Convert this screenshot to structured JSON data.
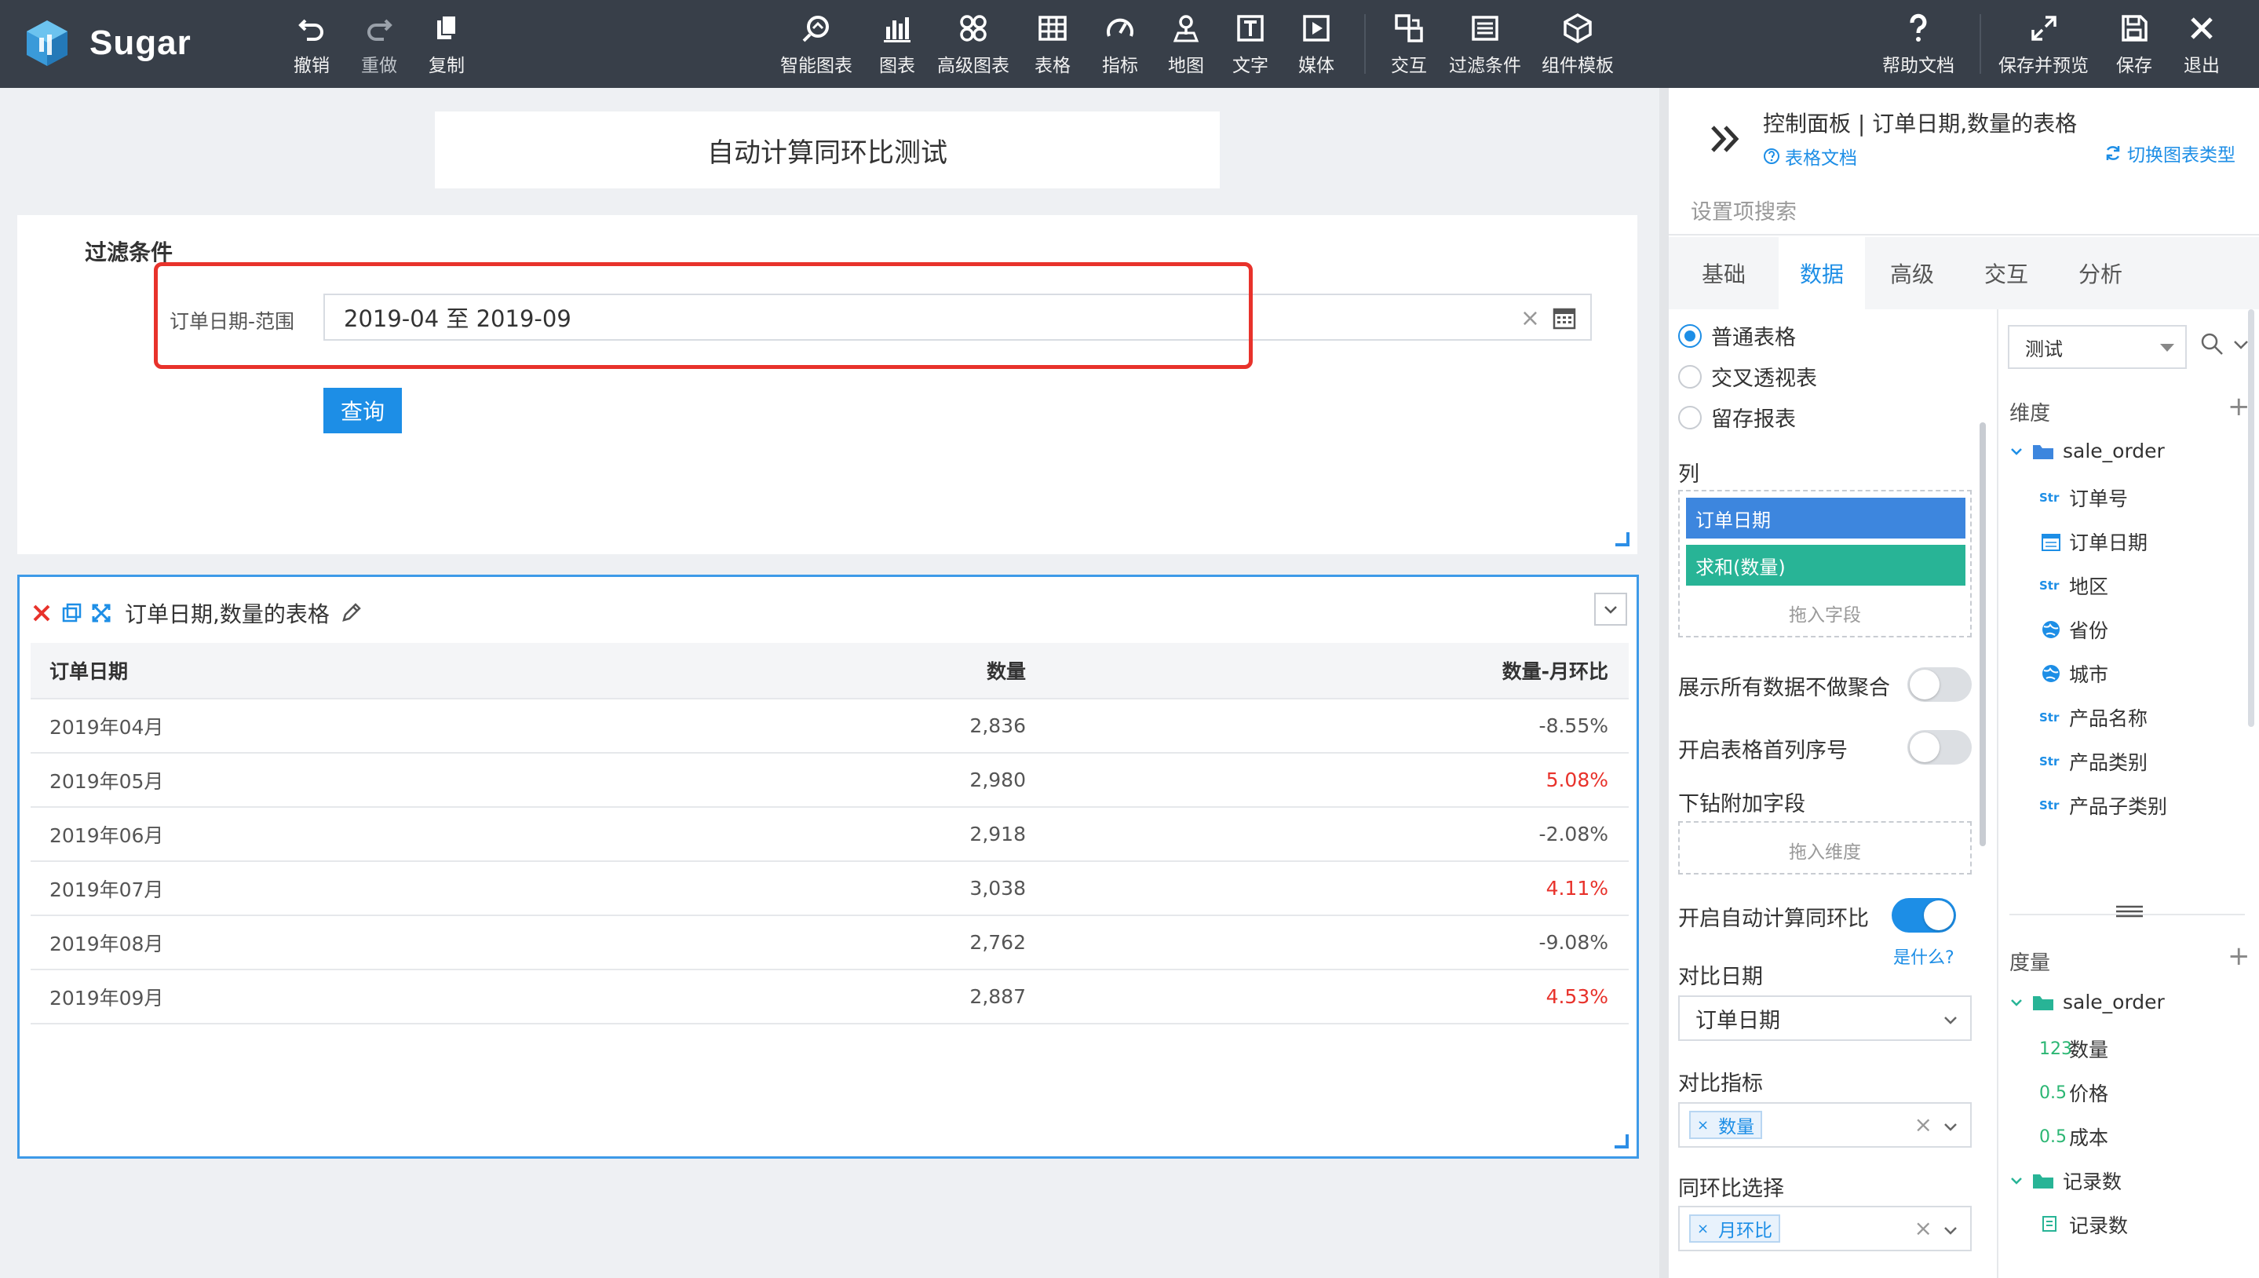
{
  "app": {
    "name": "Sugar",
    "colors": {
      "topbar": "#383f49",
      "accent": "#1d8ee6",
      "danger": "#e8322b",
      "field_blue": "#3d86de",
      "measure_green": "#28b496"
    }
  },
  "toolbar": {
    "undo": "撤销",
    "redo": "重做",
    "copy": "复制",
    "smart_chart": "智能图表",
    "chart": "图表",
    "adv_chart": "高级图表",
    "table": "表格",
    "indicator": "指标",
    "map": "地图",
    "text": "文字",
    "media": "媒体",
    "interact": "交互",
    "filter": "过滤条件",
    "widget_tpl": "组件模板",
    "help": "帮助文档",
    "save_preview": "保存并预览",
    "save": "保存",
    "exit": "退出"
  },
  "canvas": {
    "page_title": "自动计算同环比测试",
    "filter": {
      "title": "过滤条件",
      "field_label": "订单日期-范围",
      "value": "2019-04 至 2019-09",
      "clear_glyph": "×",
      "query_btn": "查询"
    },
    "table_widget": {
      "title": "订单日期,数量的表格",
      "columns": [
        "订单日期",
        "数量",
        "数量-月环比"
      ],
      "rows": [
        {
          "date": "2019年04月",
          "qty": "2,836",
          "mom": "-8.55%",
          "up": false
        },
        {
          "date": "2019年05月",
          "qty": "2,980",
          "mom": "5.08%",
          "up": true
        },
        {
          "date": "2019年06月",
          "qty": "2,918",
          "mom": "-2.08%",
          "up": false
        },
        {
          "date": "2019年07月",
          "qty": "3,038",
          "mom": "4.11%",
          "up": true
        },
        {
          "date": "2019年08月",
          "qty": "2,762",
          "mom": "-9.08%",
          "up": false
        },
        {
          "date": "2019年09月",
          "qty": "2,887",
          "mom": "4.53%",
          "up": true
        }
      ]
    }
  },
  "panel": {
    "title": "控制面板 | 订单日期,数量的表格",
    "doc_link": "表格文档",
    "switch_link": "切换图表类型",
    "search_placeholder": "设置项搜索",
    "tabs": [
      "基础",
      "数据",
      "高级",
      "交互",
      "分析"
    ],
    "active_tab": "数据",
    "table_types": [
      "普通表格",
      "交叉透视表",
      "留存报表"
    ],
    "columns_label": "列",
    "column_chips": [
      "订单日期",
      "求和(数量)"
    ],
    "drop_field_hint": "拖入字段",
    "show_all_label": "展示所有数据不做聚合",
    "row_index_label": "开启表格首列序号",
    "drill_label": "下钻附加字段",
    "drop_dim_hint": "拖入维度",
    "auto_calc_label": "开启自动计算同环比",
    "what_link": "是什么?",
    "compare_date_label": "对比日期",
    "compare_date_value": "订单日期",
    "compare_metric_label": "对比指标",
    "compare_metric_tag": "数量",
    "period_label": "同环比选择",
    "period_tag": "月环比",
    "clear_glyph": "×",
    "tag_x": "×"
  },
  "fields": {
    "dataset": "测试",
    "dim_label": "维度",
    "measure_label": "度量",
    "plus": "+",
    "dim_table": "sale_order",
    "dims": [
      {
        "type": "Str",
        "name": "订单号"
      },
      {
        "type": "date",
        "name": "订单日期"
      },
      {
        "type": "Str",
        "name": "地区"
      },
      {
        "type": "geo",
        "name": "省份"
      },
      {
        "type": "geo",
        "name": "城市"
      },
      {
        "type": "Str",
        "name": "产品名称"
      },
      {
        "type": "Str",
        "name": "产品类别"
      },
      {
        "type": "Str",
        "name": "产品子类别"
      }
    ],
    "measure_table": "sale_order",
    "measures": [
      {
        "type": "123",
        "name": "数量"
      },
      {
        "type": "0.5",
        "name": "价格"
      },
      {
        "type": "0.5",
        "name": "成本"
      }
    ],
    "count_folder": "记录数",
    "count_item": "记录数"
  }
}
